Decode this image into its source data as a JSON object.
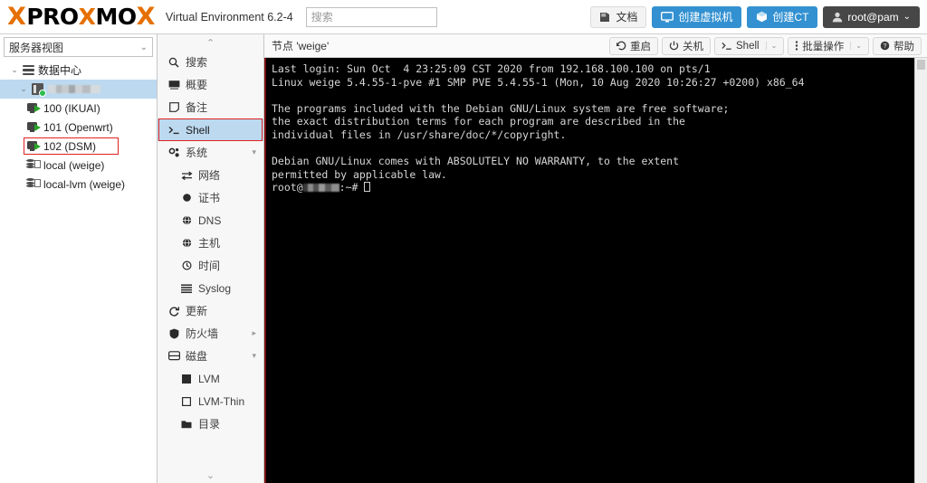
{
  "topbar": {
    "brand_x": "X",
    "brand_p1": "PRO",
    "brand_x2": "X",
    "brand_p2": "MO",
    "brand_x3": "X",
    "product": "Virtual Environment 6.2-4",
    "search_placeholder": "搜索",
    "search_value": "",
    "buttons": [
      {
        "label": "文档",
        "icon": "book-icon",
        "style": "plain"
      },
      {
        "label": "创建虚拟机",
        "icon": "monitor-icon",
        "style": "blue"
      },
      {
        "label": "创建CT",
        "icon": "cube-icon",
        "style": "blue"
      },
      {
        "label": "root@pam",
        "icon": "user-icon",
        "style": "dark",
        "caret": "⌄"
      }
    ]
  },
  "tree": {
    "view_selector": "服务器视图",
    "view_caret": "⌄",
    "nodes": [
      {
        "label": "数据中心",
        "icon": "datacenter-icon",
        "level": 0,
        "twisty": "⌄",
        "selected": false
      },
      {
        "label": "",
        "icon": "server-icon",
        "level": 1,
        "twisty": "⌄",
        "selected": true,
        "blurred": true
      },
      {
        "label": "100 (IKUAI)",
        "icon": "vm-icon",
        "level": 2,
        "twisty": "",
        "selected": false
      },
      {
        "label": "101 (Openwrt)",
        "icon": "vm-icon",
        "level": 2,
        "twisty": "",
        "selected": false
      },
      {
        "label": "102 (DSM)",
        "icon": "vm-icon",
        "level": 2,
        "twisty": "",
        "selected": false,
        "highlight_box": true
      },
      {
        "label": "local (weige)",
        "icon": "storage-icon",
        "level": 2,
        "twisty": "",
        "selected": false
      },
      {
        "label": "local-lvm (weige)",
        "icon": "storage-icon",
        "level": 2,
        "twisty": "",
        "selected": false
      }
    ]
  },
  "menu": {
    "scroll_up": "⌃",
    "scroll_down": "⌄",
    "items": [
      {
        "label": "搜索",
        "icon": "search-icon",
        "sub": false,
        "selected": false,
        "arrow": ""
      },
      {
        "label": "概要",
        "icon": "summary-icon",
        "sub": false,
        "selected": false,
        "arrow": ""
      },
      {
        "label": "备注",
        "icon": "notes-icon",
        "sub": false,
        "selected": false,
        "arrow": ""
      },
      {
        "label": "Shell",
        "icon": "terminal-icon",
        "sub": false,
        "selected": true,
        "arrow": "",
        "highlight_box": true
      },
      {
        "label": "系统",
        "icon": "system-icon",
        "sub": false,
        "selected": false,
        "arrow": "▾"
      },
      {
        "label": "网络",
        "icon": "network-icon",
        "sub": true,
        "selected": false,
        "arrow": ""
      },
      {
        "label": "证书",
        "icon": "certificate-icon",
        "sub": true,
        "selected": false,
        "arrow": ""
      },
      {
        "label": "DNS",
        "icon": "dns-icon",
        "sub": true,
        "selected": false,
        "arrow": ""
      },
      {
        "label": "主机",
        "icon": "host-icon",
        "sub": true,
        "selected": false,
        "arrow": ""
      },
      {
        "label": "时间",
        "icon": "clock-icon",
        "sub": true,
        "selected": false,
        "arrow": ""
      },
      {
        "label": "Syslog",
        "icon": "syslog-icon",
        "sub": true,
        "selected": false,
        "arrow": ""
      },
      {
        "label": "更新",
        "icon": "refresh-icon",
        "sub": false,
        "selected": false,
        "arrow": ""
      },
      {
        "label": "防火墙",
        "icon": "shield-icon",
        "sub": false,
        "selected": false,
        "arrow": "▸"
      },
      {
        "label": "磁盘",
        "icon": "disk-icon",
        "sub": false,
        "selected": false,
        "arrow": "▾"
      },
      {
        "label": "LVM",
        "icon": "lvm-icon",
        "sub": true,
        "selected": false,
        "arrow": ""
      },
      {
        "label": "LVM-Thin",
        "icon": "lvmthin-icon",
        "sub": true,
        "selected": false,
        "arrow": ""
      },
      {
        "label": "目录",
        "icon": "folder-icon",
        "sub": true,
        "selected": false,
        "arrow": ""
      }
    ]
  },
  "content": {
    "node_title": "节点 'weige'",
    "header_buttons": [
      {
        "label": "重启",
        "icon": "restart-icon",
        "caret": ""
      },
      {
        "label": "关机",
        "icon": "power-icon",
        "caret": ""
      },
      {
        "label": "Shell",
        "icon": "terminal-icon",
        "caret": "⌄"
      },
      {
        "label": "批量操作",
        "icon": "dots-icon",
        "caret": "⌄"
      },
      {
        "label": "帮助",
        "icon": "help-icon",
        "caret": ""
      }
    ]
  },
  "terminal": {
    "line1": "Last login: Sun Oct  4 23:25:09 CST 2020 from 192.168.100.100 on pts/1",
    "line2": "Linux weige 5.4.55-1-pve #1 SMP PVE 5.4.55-1 (Mon, 10 Aug 2020 10:26:27 +0200) x86_64",
    "line3": "",
    "line4": "The programs included with the Debian GNU/Linux system are free software;",
    "line5": "the exact distribution terms for each program are described in the",
    "line6": "individual files in /usr/share/doc/*/copyright.",
    "line7": "",
    "line8": "Debian GNU/Linux comes with ABSOLUTELY NO WARRANTY, to the extent",
    "line9": "permitted by applicable law.",
    "prompt_prefix": "root@",
    "prompt_suffix": ":~# "
  }
}
